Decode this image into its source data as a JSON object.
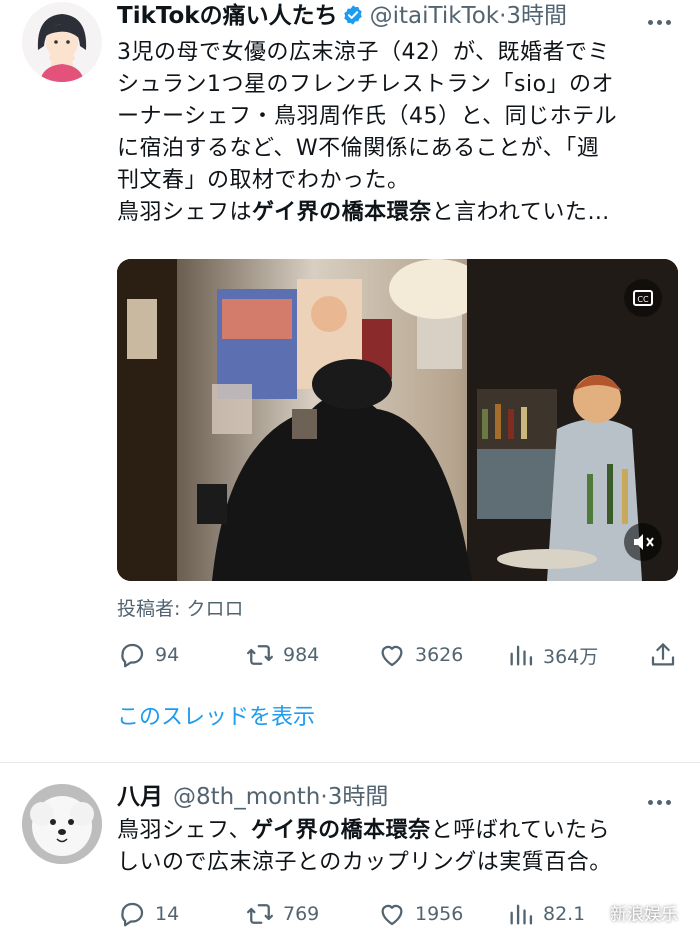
{
  "tweet1": {
    "display_name": "TikTokの痛い人たち",
    "handle": "@itaiTikTok",
    "dot": "·",
    "time": "3時間",
    "text_lines": [
      "3児の母で女優の広末涼子（42）が、既婚者でミ",
      "シュラン1つ星のフレンチレストラン「sio」のオ",
      "ーナーシェフ・鳥羽周作氏（45）と、同じホテル",
      "に宿泊するなど、W不倫関係にあることが、「週",
      "刊文春」の取材でわかった。"
    ],
    "last_line": {
      "before": "鳥羽シェフは",
      "bold": "ゲイ界の橋本環奈",
      "after": "と言われていた…"
    },
    "credit": "投稿者: クロロ",
    "actions": {
      "replies": "94",
      "retweets": "984",
      "likes": "3626",
      "views": "364万"
    },
    "show_thread": "このスレッドを表示"
  },
  "tweet2": {
    "display_name": "八月",
    "handle": "@8th_month",
    "dot": "·",
    "time": "3時間",
    "line1": {
      "before": "鳥羽シェフ、",
      "bold": "ゲイ界の橋本環奈",
      "after": "と呼ばれていたら"
    },
    "line2": "しいので広末涼子とのカップリングは実質百合。",
    "actions": {
      "replies": "14",
      "retweets": "769",
      "likes": "1956",
      "views": "82.1"
    }
  },
  "watermark": "新浪娱乐",
  "colors": {
    "text": "#0f1419",
    "secondary": "#536471",
    "link": "#1d9bf0",
    "verified": "#1d9bf0",
    "divider": "#e6e9ec"
  },
  "icons": {
    "reply": "reply-icon",
    "retweet": "retweet-icon",
    "like": "heart-icon",
    "views": "views-chart-icon",
    "share": "share-icon",
    "more": "more-icon",
    "verified": "verified-badge-icon",
    "captions": "captions-icon",
    "mute": "mute-icon"
  }
}
